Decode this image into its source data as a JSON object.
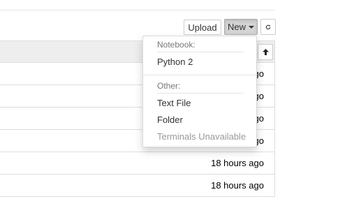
{
  "toolbar": {
    "upload_label": "Upload",
    "new_label": "New",
    "refresh_icon": "refresh-icon"
  },
  "table": {
    "sort_icon": "arrow-up-icon",
    "rows": [
      {
        "modified": "ago"
      },
      {
        "modified": "ago"
      },
      {
        "modified": "ago"
      },
      {
        "modified": "ago"
      },
      {
        "modified": "18 hours ago"
      },
      {
        "modified": "18 hours ago"
      }
    ]
  },
  "new_menu": {
    "notebook_header": "Notebook:",
    "python2": "Python 2",
    "other_header": "Other:",
    "text_file": "Text File",
    "folder": "Folder",
    "terminals": "Terminals Unavailable"
  }
}
